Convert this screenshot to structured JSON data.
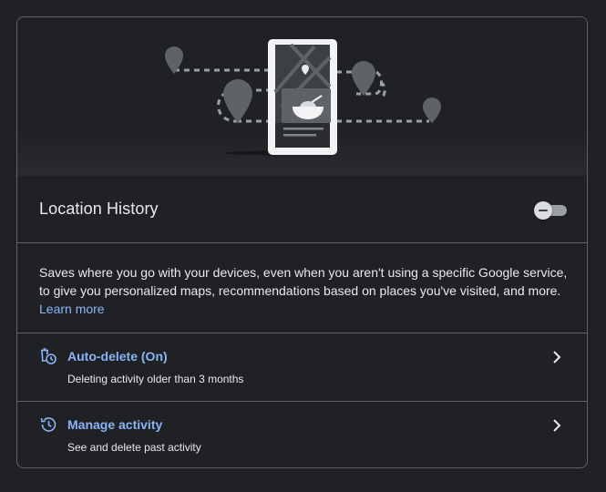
{
  "location_history": {
    "title": "Location History",
    "toggle_state": "off",
    "description": "Saves where you go with your devices, even when you aren't using a specific Google service, to give you personalized maps, recommendations based on places you've visited, and more.",
    "learn_more": "Learn more"
  },
  "items": [
    {
      "label": "Auto-delete (On)",
      "sub": "Deleting activity older than 3 months",
      "icon": "auto-delete-icon"
    },
    {
      "label": "Manage activity",
      "sub": "See and delete past activity",
      "icon": "history-icon"
    }
  ],
  "colors": {
    "background": "#202124",
    "border": "#5f6368",
    "accent": "#8ab4f8",
    "text": "#e8eaed"
  }
}
